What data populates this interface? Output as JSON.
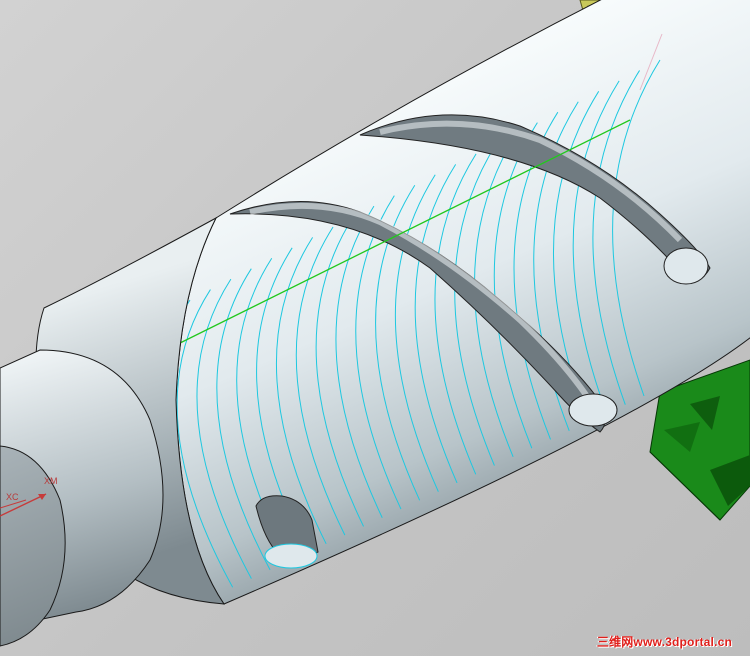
{
  "viewport": {
    "name": "3D graphics window",
    "model": "screw shaft with helical groove and helix curve set"
  },
  "triad": {
    "xm_label": "XM",
    "xc_label": "XC"
  },
  "colors": {
    "background": "#c8c8c8",
    "shaft_highlight": "#f0f6f8",
    "shaft_shadow": "#9aa7ad",
    "helix_curves": "#1ec8e0",
    "axis_line": "#22c81e",
    "fixture": "#1a8a1a",
    "bracket": "#c8c85a",
    "watermark": "#e0201c"
  },
  "watermark": {
    "text": "三维网www.3dportal.cn"
  }
}
